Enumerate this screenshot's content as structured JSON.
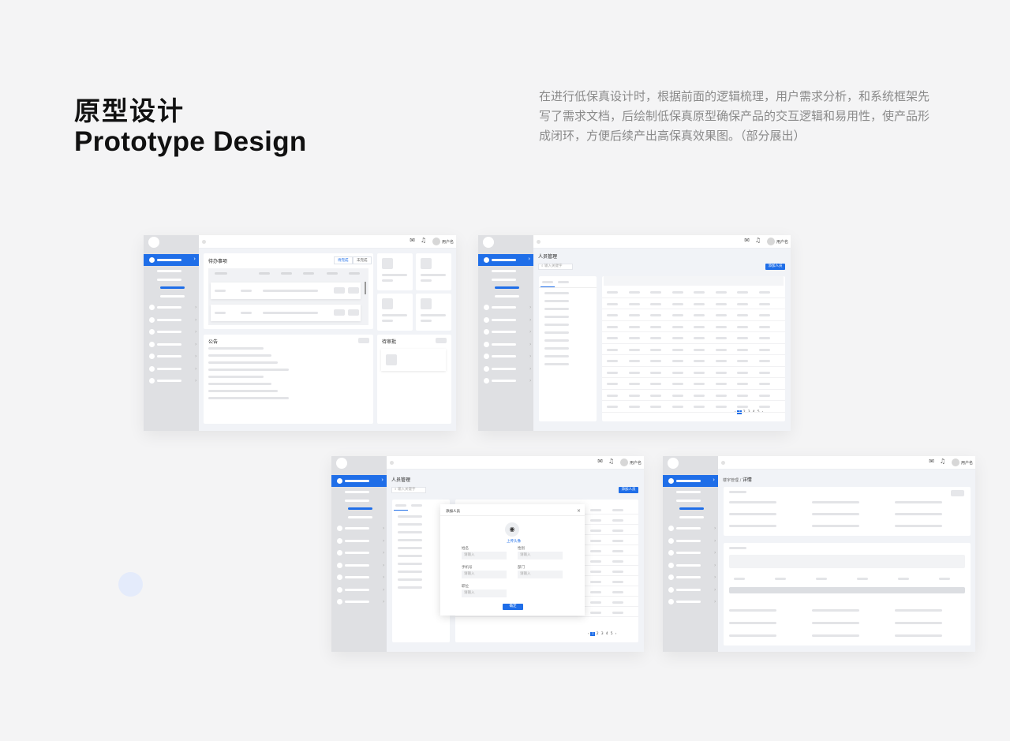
{
  "heading": {
    "cn": "原型设计",
    "en": "Prototype Design"
  },
  "description": "在进行低保真设计时，根据前面的逻辑梳理，用户需求分析，和系统框架先写了需求文档，后绘制低保真原型确保产品的交互逻辑和易用性，使产品形成闭环，方便后续产出高保真效果图。（部分展出）",
  "topbar": {
    "username": "用户名",
    "mail_icon": "mail-icon",
    "bell_icon": "bell-icon"
  },
  "dashboard": {
    "todo_title": "待办事项",
    "todo_tabs": [
      "待完成",
      "未完成"
    ],
    "notice_title": "公告",
    "approval_title": "待审批"
  },
  "personnel": {
    "title": "人员管理",
    "search_placeholder": "输入关键字",
    "add_button": "添加人员",
    "pages": [
      "1",
      "2",
      "3",
      "4",
      "5"
    ]
  },
  "add_modal": {
    "title": "添加人员",
    "upload_label": "上传头像",
    "fields": [
      {
        "label": "姓名",
        "placeholder": "请输入"
      },
      {
        "label": "性别",
        "placeholder": "请输入"
      },
      {
        "label": "手机号",
        "placeholder": "请输入"
      },
      {
        "label": "部门",
        "placeholder": "请输入"
      },
      {
        "label": "职位",
        "placeholder": "请输入"
      }
    ],
    "confirm": "确定",
    "close": "×"
  },
  "detail": {
    "breadcrumb_parent": "楼宇管理",
    "breadcrumb_sep": " / ",
    "breadcrumb_current": "详情"
  }
}
